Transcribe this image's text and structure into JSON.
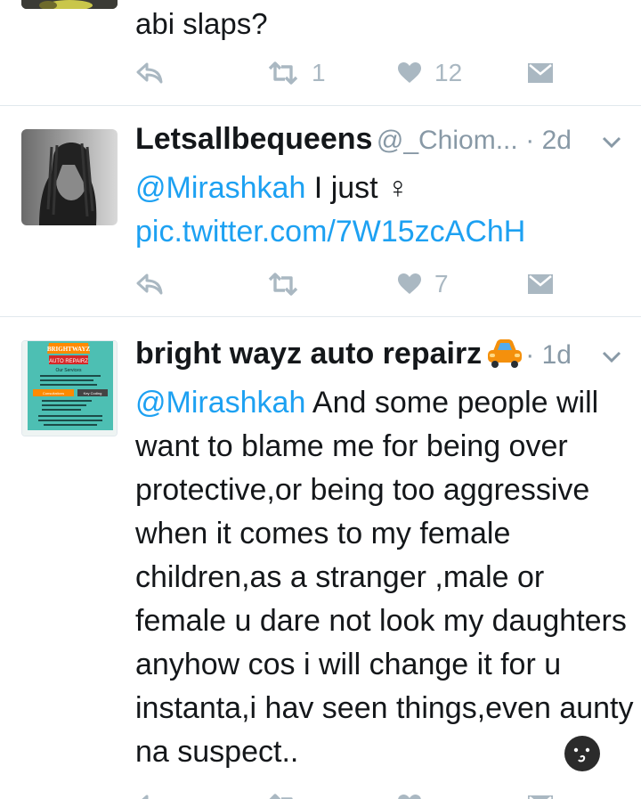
{
  "tweets": [
    {
      "text": "abi slaps?",
      "retweets": "1",
      "likes": "12"
    },
    {
      "name": "Letsallbequeens",
      "handle": "@_Chiom...",
      "time": "· 2d",
      "mention": "@Mirashkah",
      "text": " I just  ♀",
      "link": "pic.twitter.com/7W15zcAChH",
      "likes": "7"
    },
    {
      "name": "bright wayz auto repairz",
      "name_emoji": "car",
      "time": "· 1d",
      "mention": "@Mirashkah",
      "text": " And some people will want to blame me for being over protective,or being too aggressive when it comes to my female children,as a stranger ,male or female u dare not look my daughters anyhow cos i will change it for u instanta,i hav seen things,even aunty na suspect..",
      "avatar_texts": [
        "BRIGHTWAYZ",
        "AUTO REPAIRZ",
        "Our Services",
        "Consultations",
        "Key Coding"
      ]
    }
  ],
  "colors": {
    "link": "#1da1f2",
    "muted": "#8899a6",
    "icon": "#aab8c2",
    "divider": "#e1e8ed"
  }
}
